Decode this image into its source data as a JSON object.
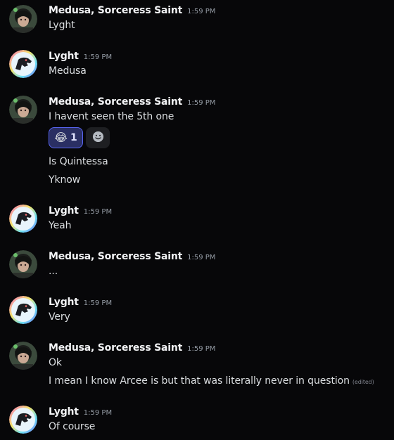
{
  "colors": {
    "background": "#070709",
    "username": "#f2f3f5",
    "message_text": "#dbdee1",
    "timestamp": "#949ba4",
    "reaction_active_bg": "#2a2f63",
    "reaction_active_border": "#5865f2"
  },
  "messages": [
    {
      "author": "Medusa, Sorceress Saint",
      "avatar": "medusa-avatar",
      "time": "1:59 PM",
      "lines": [
        "Lyght"
      ]
    },
    {
      "author": "Lyght",
      "avatar": "lyght-dino-avatar",
      "time": "1:59 PM",
      "lines": [
        "Medusa"
      ]
    },
    {
      "author": "Medusa, Sorceress Saint",
      "avatar": "medusa-avatar",
      "time": "1:59 PM",
      "lines": [
        "I havent seen the 5th one",
        "Is Quintessa",
        "Yknow"
      ]
    },
    {
      "author": "Lyght",
      "avatar": "lyght-dino-avatar",
      "time": "1:59 PM",
      "lines": [
        "Yeah"
      ]
    },
    {
      "author": "Medusa, Sorceress Saint",
      "avatar": "medusa-avatar",
      "time": "1:59 PM",
      "lines": [
        "..."
      ]
    },
    {
      "author": "Lyght",
      "avatar": "lyght-dino-avatar",
      "time": "1:59 PM",
      "lines": [
        "Very"
      ]
    },
    {
      "author": "Medusa, Sorceress Saint",
      "avatar": "medusa-avatar",
      "time": "1:59 PM",
      "lines": [
        "Ok",
        "I mean I know Arcee is but that was literally never in question"
      ],
      "edited_label": "(edited)"
    },
    {
      "author": "Lyght",
      "avatar": "lyght-dino-avatar",
      "time": "1:59 PM",
      "lines": [
        "Of course"
      ]
    }
  ],
  "reaction": {
    "emoji": "😂",
    "count": "1",
    "icon": "joy-emoji",
    "add_icon": "add-reaction-smiley-icon"
  }
}
